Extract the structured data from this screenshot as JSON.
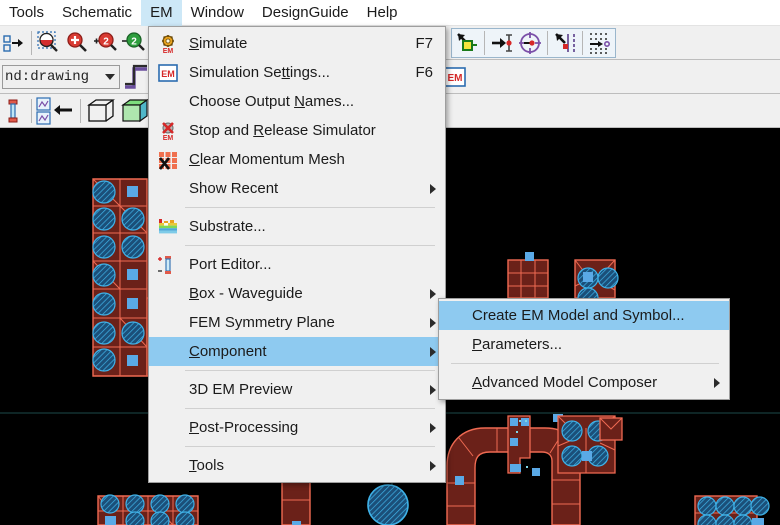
{
  "menubar": {
    "items": [
      {
        "label": "Tools",
        "active": false
      },
      {
        "label": "Schematic",
        "active": false
      },
      {
        "label": "EM",
        "active": true
      },
      {
        "label": "Window",
        "active": false
      },
      {
        "label": "DesignGuide",
        "active": false
      },
      {
        "label": "Help",
        "active": false
      }
    ]
  },
  "toolbars": {
    "row1": {
      "icons": [
        "move-hierarchy-icon",
        "zoom-area-icon",
        "zoom-in-icon",
        "zoom-in-2x-icon",
        "zoom-out-2x-icon",
        "measure-icon"
      ],
      "right_icons": [
        "insert-pin-icon",
        "insert-port-icon",
        "insert-circle-port-icon",
        "snap-port-icon",
        "insert-array-icon"
      ]
    },
    "row2": {
      "combo_value": "nd:drawing",
      "step_icon": "step-waveform-icon",
      "em_icon": "em-badge-icon"
    },
    "row3": {
      "icons": [
        "port-editor-icon",
        "substrate-stack-icon",
        "arrow-left-icon",
        "wireframe-cube-icon",
        "solid-cube-icon",
        "rainbow-block-icon"
      ]
    }
  },
  "em_menu": {
    "items": [
      {
        "type": "item",
        "name": "simulate",
        "label": "Simulate",
        "label_pre": "",
        "mnemonic": "S",
        "label_post": "imulate",
        "accel": "F7",
        "icon": "em-gear-icon",
        "submenu": false
      },
      {
        "type": "item",
        "name": "simulation-settings",
        "label": "Simulation Settings...",
        "label_pre": "Simulation Se",
        "mnemonic": "tt",
        "label_post": "ings...",
        "accel": "F6",
        "icon": "em-box-icon",
        "submenu": false
      },
      {
        "type": "item",
        "name": "choose-output-names",
        "label": "Choose Output Names...",
        "label_pre": "Choose Output ",
        "mnemonic": "N",
        "label_post": "ames...",
        "accel": "",
        "icon": "",
        "submenu": false
      },
      {
        "type": "item",
        "name": "stop-release-simulator",
        "label": "Stop and Release Simulator",
        "label_pre": "Stop and ",
        "mnemonic": "R",
        "label_post": "elease Simulator",
        "accel": "",
        "icon": "em-stop-icon",
        "submenu": false
      },
      {
        "type": "item",
        "name": "clear-momentum-mesh",
        "label": "Clear Momentum Mesh",
        "label_pre": "",
        "mnemonic": "C",
        "label_post": "lear Momentum Mesh",
        "accel": "",
        "icon": "clear-mesh-icon",
        "submenu": false
      },
      {
        "type": "item",
        "name": "show-recent",
        "label": "Show Recent",
        "label_pre": "Show Recent",
        "mnemonic": "",
        "label_post": "",
        "accel": "",
        "icon": "",
        "submenu": true
      },
      {
        "type": "separator"
      },
      {
        "type": "item",
        "name": "substrate",
        "label": "Substrate...",
        "label_pre": "Substrate...",
        "mnemonic": "",
        "label_post": "",
        "accel": "",
        "icon": "substrate-icon",
        "submenu": false
      },
      {
        "type": "separator"
      },
      {
        "type": "item",
        "name": "port-editor",
        "label": "Port Editor...",
        "label_pre": "Port Editor...",
        "mnemonic": "",
        "label_post": "",
        "accel": "",
        "icon": "port-editor-icon",
        "submenu": false
      },
      {
        "type": "item",
        "name": "box-waveguide",
        "label": "Box - Waveguide",
        "label_pre": "",
        "mnemonic": "B",
        "label_post": "ox - Waveguide",
        "accel": "",
        "icon": "",
        "submenu": true
      },
      {
        "type": "item",
        "name": "fem-symmetry-plane",
        "label": "FEM Symmetry Plane",
        "label_pre": "FEM Symmetry Plane",
        "mnemonic": "",
        "label_post": "",
        "accel": "",
        "icon": "",
        "submenu": true
      },
      {
        "type": "item",
        "name": "component",
        "label": "Component",
        "label_pre": "",
        "mnemonic": "C",
        "label_post": "omponent",
        "accel": "",
        "icon": "",
        "submenu": true,
        "selected": true
      },
      {
        "type": "separator"
      },
      {
        "type": "item",
        "name": "3d-em-preview",
        "label": "3D EM Preview",
        "label_pre": "3D EM Preview",
        "mnemonic": "",
        "label_post": "",
        "accel": "",
        "icon": "",
        "submenu": true
      },
      {
        "type": "separator"
      },
      {
        "type": "item",
        "name": "post-processing",
        "label": "Post-Processing",
        "label_pre": "",
        "mnemonic": "P",
        "label_post": "ost-Processing",
        "accel": "",
        "icon": "",
        "submenu": true
      },
      {
        "type": "separator"
      },
      {
        "type": "item",
        "name": "tools",
        "label": "Tools",
        "label_pre": "",
        "mnemonic": "T",
        "label_post": "ools",
        "accel": "",
        "icon": "",
        "submenu": true
      }
    ]
  },
  "component_submenu": {
    "items": [
      {
        "type": "item",
        "name": "create-em-model-and-symbol",
        "label": "Create EM Model and Symbol...",
        "label_pre": "Create EM Model and Symbol...",
        "mnemonic": "",
        "label_post": "",
        "submenu": false,
        "selected": true
      },
      {
        "type": "item",
        "name": "parameters",
        "label": "Parameters...",
        "label_pre": "",
        "mnemonic": "P",
        "label_post": "arameters...",
        "submenu": false
      },
      {
        "type": "separator"
      },
      {
        "type": "item",
        "name": "advanced-model-composer",
        "label": "Advanced Model Composer",
        "label_pre": "",
        "mnemonic": "A",
        "label_post": "dvanced Model Composer",
        "submenu": true
      }
    ]
  },
  "colors": {
    "menu_bg": "#f0f0f0",
    "menu_highlight": "#8ecaf0",
    "menubar_active": "#cde8f7",
    "canvas_bg": "#000000",
    "mesh_fill": "#6b2119",
    "mesh_line": "#ef6a52",
    "via_fill": "#1f6fa8",
    "handle": "#5aa9e6",
    "port_marker": "#00e5f0",
    "grid_line": "#1d4a4a"
  },
  "canvas": {
    "name": "em-layout-canvas",
    "description": "Momentum EM layout with meshed metal traces, vias and port markers"
  }
}
